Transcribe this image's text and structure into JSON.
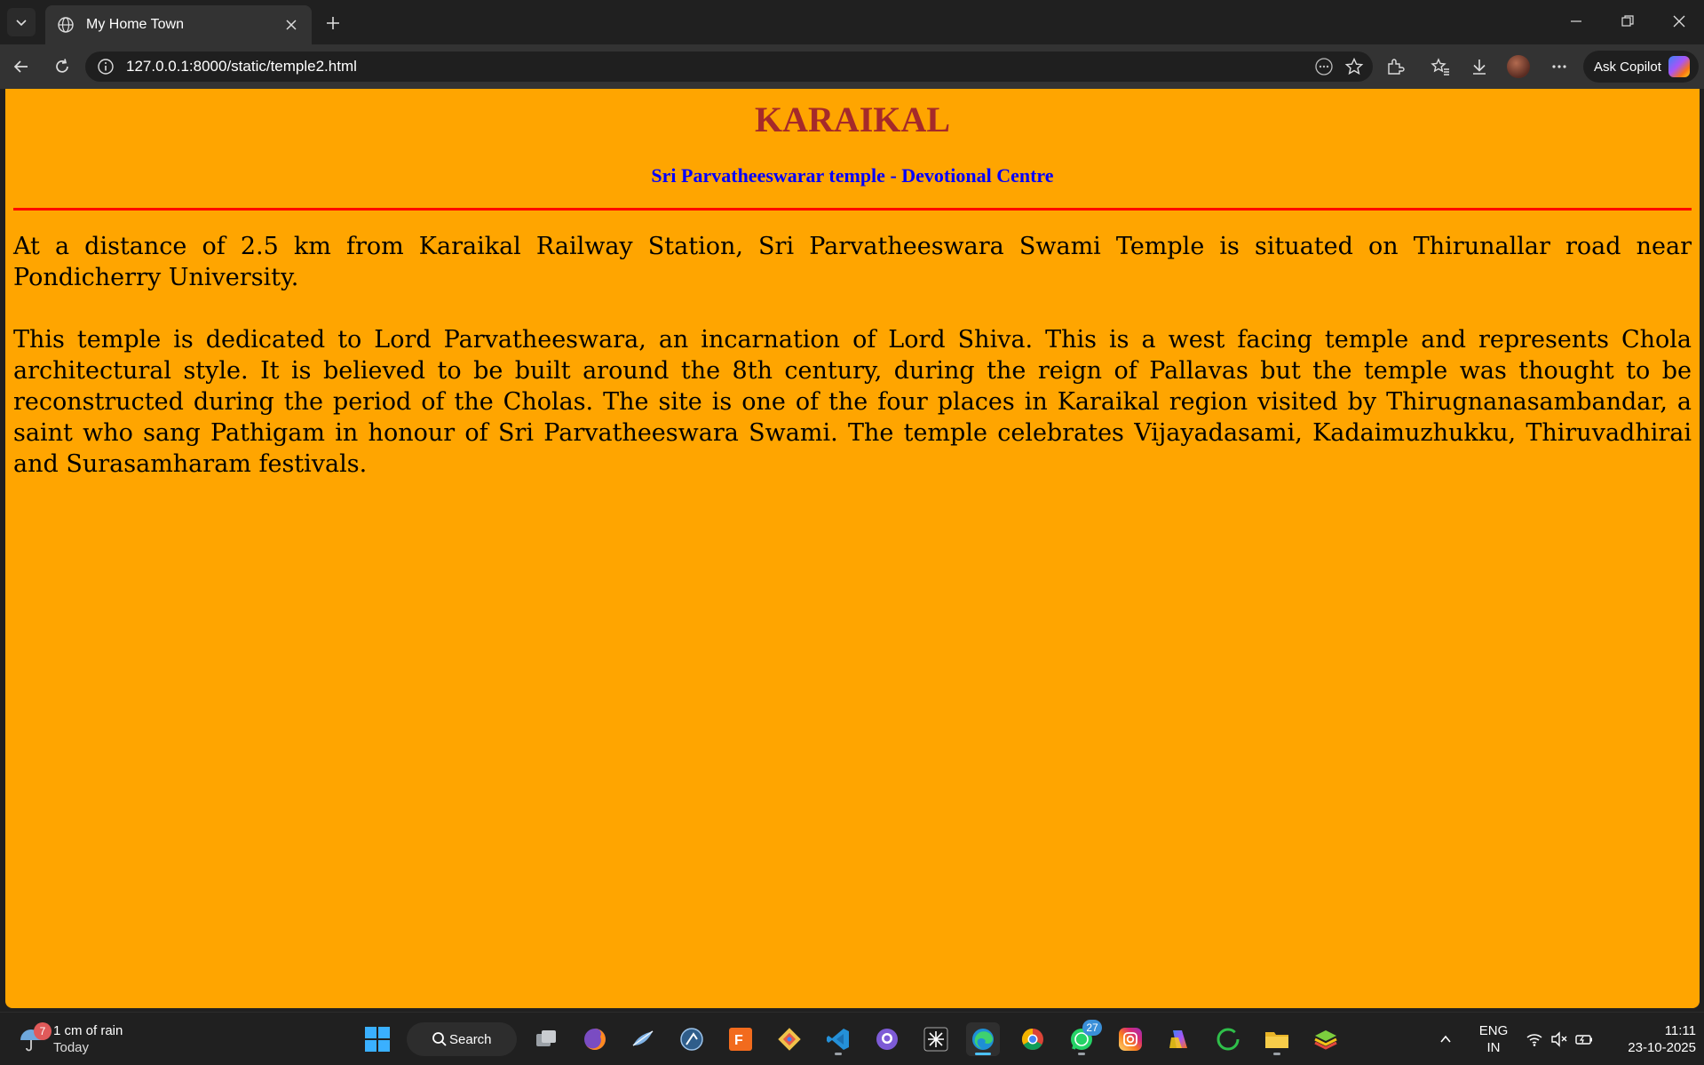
{
  "browser": {
    "tab": {
      "title": "My Home Town"
    },
    "address": {
      "url": "127.0.0.1:8000/static/temple2.html"
    },
    "copilot_label": "Ask Copilot",
    "icons": [
      "tab-actions-icon",
      "globe-icon",
      "close-icon",
      "plus-icon",
      "minimize-icon",
      "restore-icon",
      "window-close-icon",
      "back-icon",
      "refresh-icon",
      "info-icon",
      "reader-icon",
      "favorite-star-icon",
      "extensions-icon",
      "favorites-icon",
      "download-icon",
      "more-icon"
    ]
  },
  "page": {
    "heading": "KARAIKAL",
    "subheading": "Sri Parvatheeswarar temple - Devotional Centre",
    "paragraphs": [
      "At a distance of 2.5 km from Karaikal Railway Station, Sri Parvatheeswara Swami Temple is situated on Thirunallar road near Pondicherry University.",
      "This temple is dedicated to Lord Parvatheeswara, an incarnation of Lord Shiva. This is a west facing temple and represents Chola architectural style. It is believed to be built around the 8th century, during the reign of Pallavas but the temple was thought to be reconstructed during the period of the Cholas. The site is one of the four places in Karaikal region visited by Thirugnanasambandar, a saint who sang Pathigam in honour of Sri Parvatheeswara Swami. The temple celebrates Vijayadasami, Kadaimuzhukku, Thiruvadhirai and Surasamharam festivals."
    ],
    "colors": {
      "background": "#ffa500",
      "heading": "#a52a2a",
      "subheading": "#0000ff",
      "rule": "#ff0000"
    }
  },
  "taskbar": {
    "weather": {
      "badge": "7",
      "line1": "1 cm of rain",
      "line2": "Today"
    },
    "search_label": "Search",
    "whatsapp_badge": "27",
    "language": {
      "line1": "ENG",
      "line2": "IN"
    },
    "clock": {
      "time": "11:11",
      "date": "23-10-2025"
    },
    "apps": [
      "windows-start-icon",
      "search-icon",
      "task-view-icon",
      "firefox-icon",
      "app-icon",
      "app-icon",
      "fusion-360-icon",
      "git-icon",
      "vscode-icon",
      "github-icon",
      "app-icon",
      "edge-icon",
      "chrome-icon",
      "whatsapp-icon",
      "instagram-icon",
      "copilot-icon",
      "app-icon",
      "file-explorer-icon",
      "bluestacks-icon"
    ],
    "tray": [
      "chevron-up-icon",
      "wifi-icon",
      "volume-muted-icon",
      "battery-icon"
    ]
  }
}
